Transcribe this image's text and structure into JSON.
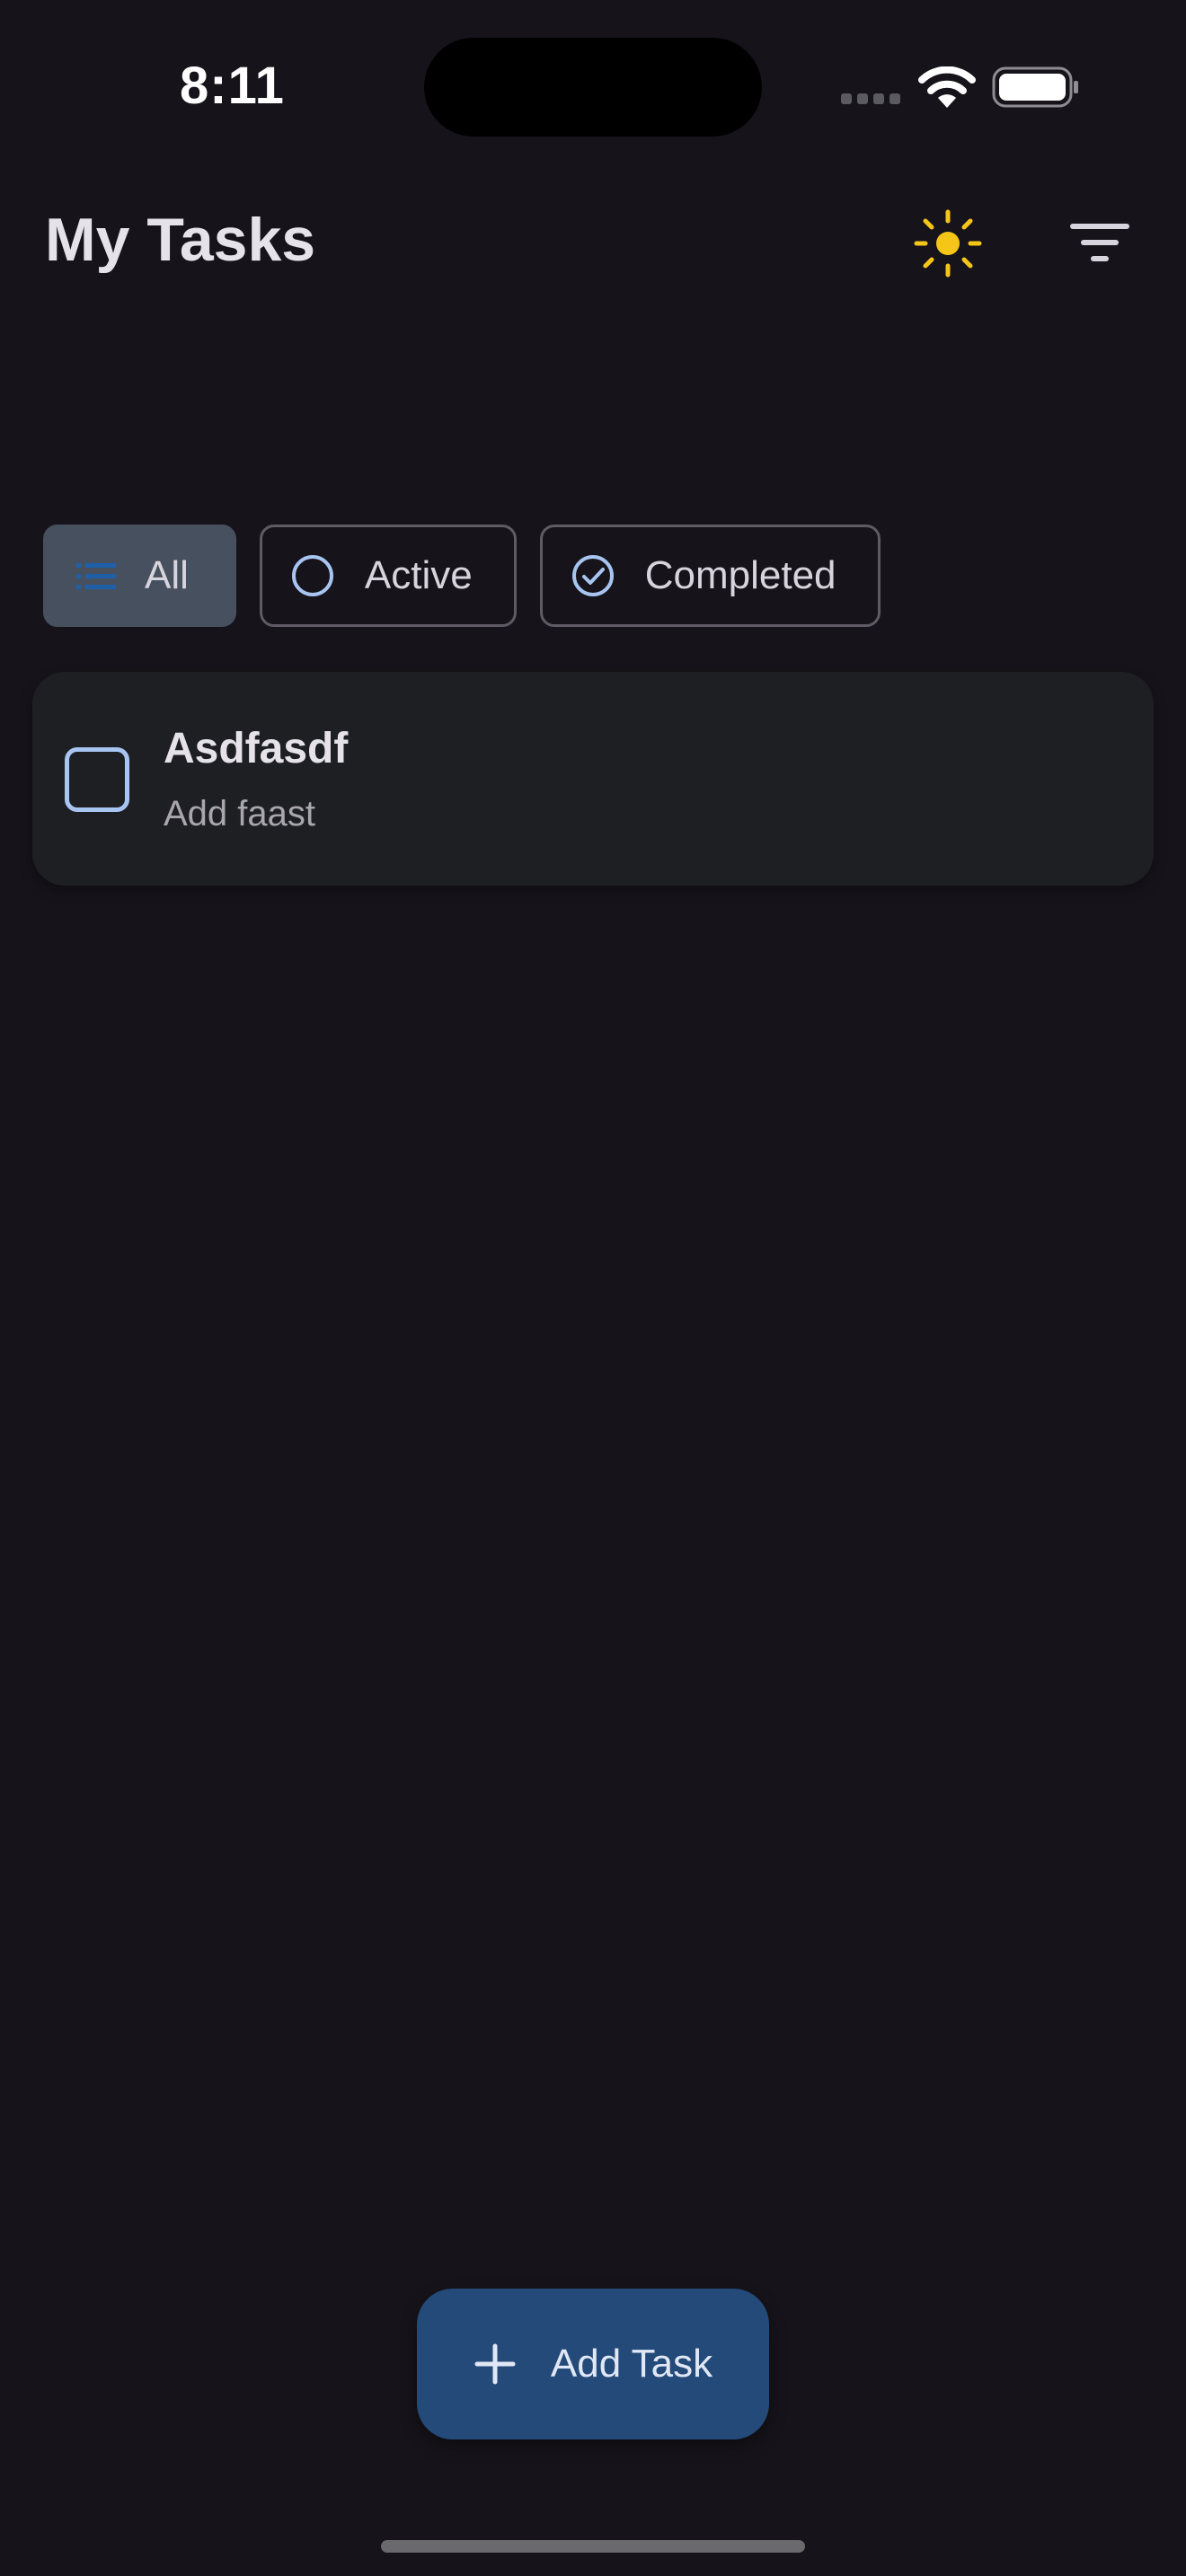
{
  "status_bar": {
    "time": "8:11"
  },
  "header": {
    "title": "My Tasks"
  },
  "filters": {
    "all_label": "All",
    "active_label": "Active",
    "completed_label": "Completed",
    "selected": "All"
  },
  "tasks": [
    {
      "title": "Asdfasdf",
      "description": "Add faast",
      "completed": false
    }
  ],
  "fab": {
    "label": "Add Task"
  },
  "colors": {
    "background": "#16141a",
    "card": "#1e1f23",
    "accent": "#a8c5f2",
    "sun": "#f5c518",
    "fab": "#244a7a",
    "selected_chip": "#46505f"
  },
  "icons": {
    "theme": "sun-icon",
    "filter": "filter-icon",
    "all": "list-icon",
    "active": "circle-icon",
    "completed": "check-circle-icon",
    "fab": "plus-icon"
  }
}
